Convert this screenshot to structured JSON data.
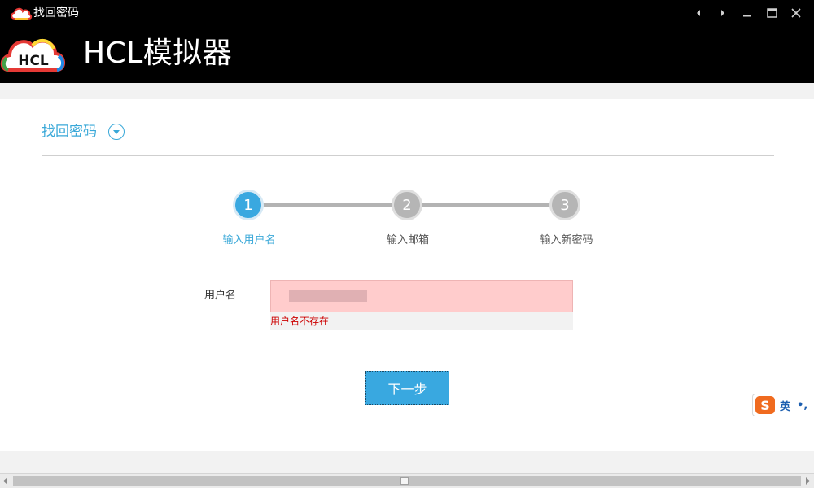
{
  "window": {
    "title": "找回密码",
    "controls": [
      "nav-prev-icon",
      "nav-next-icon",
      "minimize-icon",
      "maximize-icon",
      "close-icon"
    ]
  },
  "header": {
    "logo_text": "HCL",
    "app_name": "HCL模拟器"
  },
  "page": {
    "title": "找回密码",
    "toggle_icon": "chevron-down-icon"
  },
  "steps": [
    {
      "number": "1",
      "label": "输入用户名",
      "active": true
    },
    {
      "number": "2",
      "label": "输入邮箱",
      "active": false
    },
    {
      "number": "3",
      "label": "输入新密码",
      "active": false
    }
  ],
  "form": {
    "username_label": "用户名",
    "username_value": "",
    "error_message": "用户名不存在",
    "next_label": "下一步"
  },
  "ime": {
    "logo": "sogou-s-icon",
    "lang": "英",
    "punct": "•,"
  },
  "colors": {
    "accent": "#39a8e0",
    "error": "#cc0000",
    "field_error_bg": "#ffcccc",
    "inactive_step": "#b5b5b5"
  }
}
